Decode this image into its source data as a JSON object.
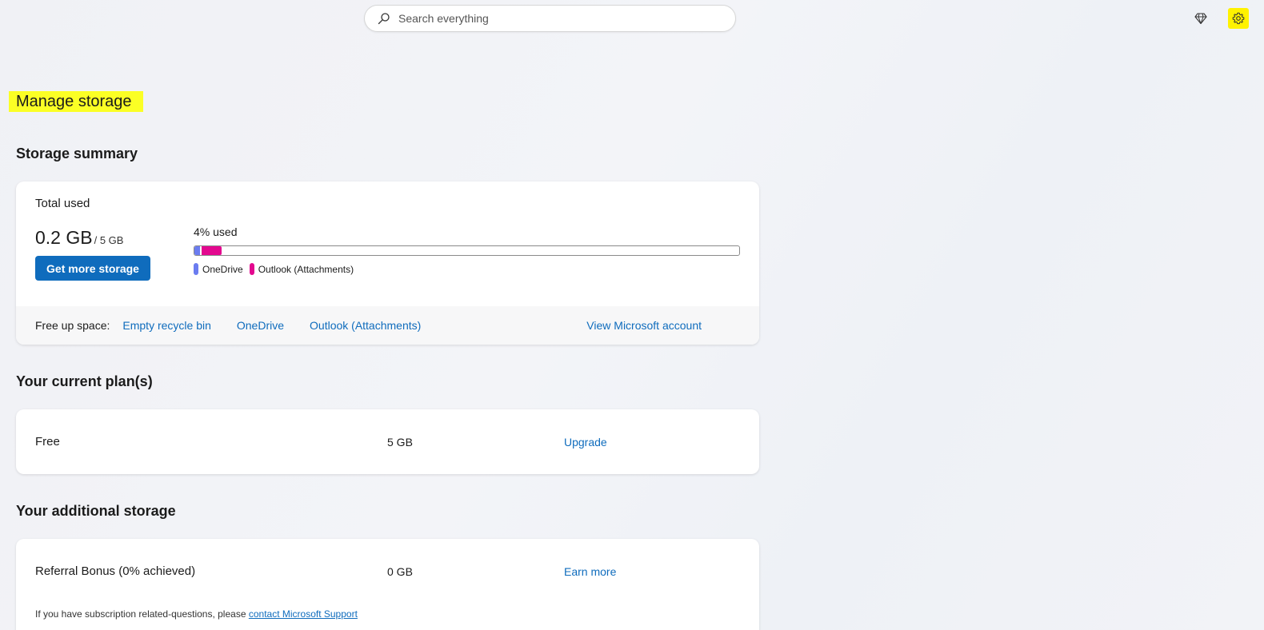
{
  "search": {
    "placeholder": "Search everything"
  },
  "header": {
    "premium_icon": "diamond-icon",
    "settings_icon": "gear-icon",
    "settings_highlight": "#fff200"
  },
  "page": {
    "title": "Manage storage",
    "title_highlight": "#fbff25"
  },
  "storage_summary": {
    "section_title": "Storage summary",
    "total_label": "Total used",
    "used_value": "0.2 GB",
    "total_value": "/ 5 GB",
    "get_more_label": "Get more storage",
    "percent_label": "4% used",
    "usage": [
      {
        "name": "OneDrive",
        "fraction": 0.011,
        "color": "#6b7cf0"
      },
      {
        "name": "Outlook (Attachments)",
        "fraction": 0.037,
        "color": "#e3088f"
      }
    ],
    "free_up": {
      "label": "Free up space:",
      "links": [
        "Empty recycle bin",
        "OneDrive",
        "Outlook (Attachments)"
      ],
      "account_link": "View Microsoft account"
    }
  },
  "current_plans": {
    "section_title": "Your current plan(s)",
    "plan": {
      "name": "Free",
      "size": "5 GB",
      "action": "Upgrade"
    }
  },
  "additional_storage": {
    "section_title": "Your additional storage",
    "item": {
      "name": "Referral Bonus (0% achieved)",
      "size": "0 GB",
      "action": "Earn more"
    },
    "support_text": "If you have subscription related-questions, please",
    "support_link": "contact Microsoft Support"
  },
  "colors": {
    "accent": "#0f6cbd"
  }
}
